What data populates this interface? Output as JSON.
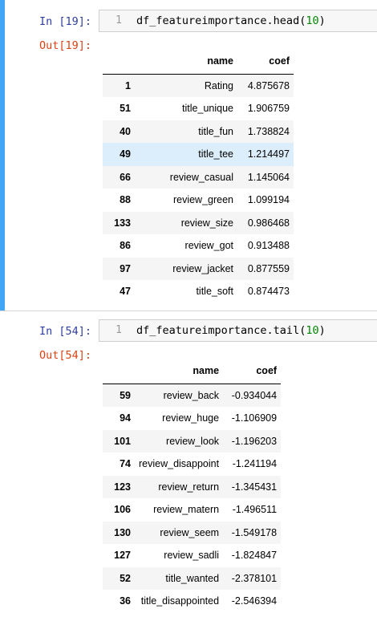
{
  "cells": [
    {
      "in_prompt": "In [19]:",
      "line_number": "1",
      "code_prefix": "df_featureimportance.head(",
      "code_arg": "10",
      "code_suffix": ")",
      "out_prompt": "Out[19]:",
      "table": {
        "columns": [
          "name",
          "coef"
        ],
        "rows": [
          {
            "index": "1",
            "name": "Rating",
            "coef": "4.875678"
          },
          {
            "index": "51",
            "name": "title_unique",
            "coef": "1.906759"
          },
          {
            "index": "40",
            "name": "title_fun",
            "coef": "1.738824"
          },
          {
            "index": "49",
            "name": "title_tee",
            "coef": "1.214497"
          },
          {
            "index": "66",
            "name": "review_casual",
            "coef": "1.145064"
          },
          {
            "index": "88",
            "name": "review_green",
            "coef": "1.099194"
          },
          {
            "index": "133",
            "name": "review_size",
            "coef": "0.986468"
          },
          {
            "index": "86",
            "name": "review_got",
            "coef": "0.913488"
          },
          {
            "index": "97",
            "name": "review_jacket",
            "coef": "0.877559"
          },
          {
            "index": "47",
            "name": "title_soft",
            "coef": "0.874473"
          }
        ]
      }
    },
    {
      "in_prompt": "In [54]:",
      "line_number": "1",
      "code_prefix": "df_featureimportance.tail(",
      "code_arg": "10",
      "code_suffix": ")",
      "out_prompt": "Out[54]:",
      "table": {
        "columns": [
          "name",
          "coef"
        ],
        "rows": [
          {
            "index": "59",
            "name": "review_back",
            "coef": "-0.934044"
          },
          {
            "index": "94",
            "name": "review_huge",
            "coef": "-1.106909"
          },
          {
            "index": "101",
            "name": "review_look",
            "coef": "-1.196203"
          },
          {
            "index": "74",
            "name": "review_disappoint",
            "coef": "-1.241194"
          },
          {
            "index": "123",
            "name": "review_return",
            "coef": "-1.345431"
          },
          {
            "index": "106",
            "name": "review_matern",
            "coef": "-1.496511"
          },
          {
            "index": "130",
            "name": "review_seem",
            "coef": "-1.549178"
          },
          {
            "index": "127",
            "name": "review_sadli",
            "coef": "-1.824847"
          },
          {
            "index": "52",
            "name": "title_wanted",
            "coef": "-2.378101"
          },
          {
            "index": "36",
            "name": "title_disappointed",
            "coef": "-2.546394"
          }
        ]
      }
    }
  ],
  "colors": {
    "selection_bar": "#42a5f5",
    "in_prompt": "#303f9f",
    "out_prompt": "#d84315",
    "number_literal": "#008800",
    "row_hover": "#dceefb"
  }
}
